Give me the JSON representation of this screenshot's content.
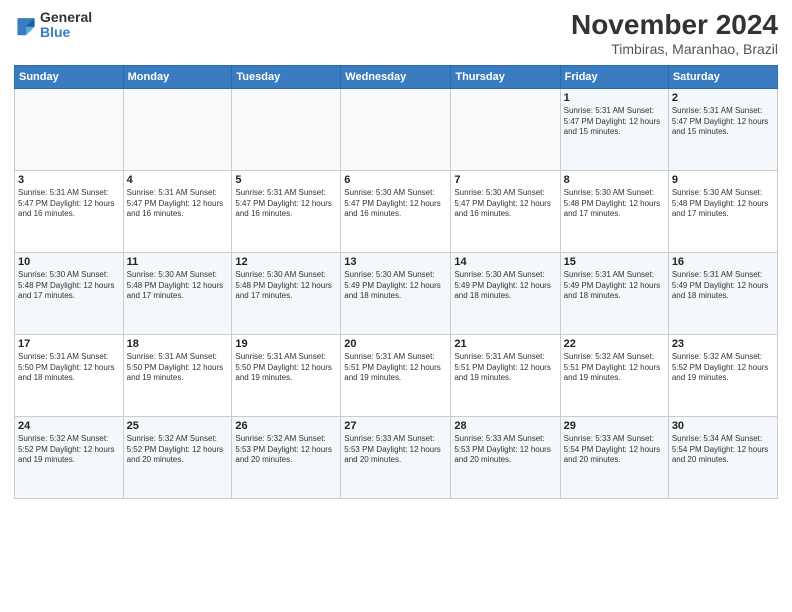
{
  "header": {
    "logo": {
      "general": "General",
      "blue": "Blue"
    },
    "title": "November 2024",
    "subtitle": "Timbiras, Maranhao, Brazil"
  },
  "weekdays": [
    "Sunday",
    "Monday",
    "Tuesday",
    "Wednesday",
    "Thursday",
    "Friday",
    "Saturday"
  ],
  "weeks": [
    [
      {
        "day": "",
        "info": ""
      },
      {
        "day": "",
        "info": ""
      },
      {
        "day": "",
        "info": ""
      },
      {
        "day": "",
        "info": ""
      },
      {
        "day": "",
        "info": ""
      },
      {
        "day": "1",
        "info": "Sunrise: 5:31 AM\nSunset: 5:47 PM\nDaylight: 12 hours\nand 15 minutes."
      },
      {
        "day": "2",
        "info": "Sunrise: 5:31 AM\nSunset: 5:47 PM\nDaylight: 12 hours\nand 15 minutes."
      }
    ],
    [
      {
        "day": "3",
        "info": "Sunrise: 5:31 AM\nSunset: 5:47 PM\nDaylight: 12 hours\nand 16 minutes."
      },
      {
        "day": "4",
        "info": "Sunrise: 5:31 AM\nSunset: 5:47 PM\nDaylight: 12 hours\nand 16 minutes."
      },
      {
        "day": "5",
        "info": "Sunrise: 5:31 AM\nSunset: 5:47 PM\nDaylight: 12 hours\nand 16 minutes."
      },
      {
        "day": "6",
        "info": "Sunrise: 5:30 AM\nSunset: 5:47 PM\nDaylight: 12 hours\nand 16 minutes."
      },
      {
        "day": "7",
        "info": "Sunrise: 5:30 AM\nSunset: 5:47 PM\nDaylight: 12 hours\nand 16 minutes."
      },
      {
        "day": "8",
        "info": "Sunrise: 5:30 AM\nSunset: 5:48 PM\nDaylight: 12 hours\nand 17 minutes."
      },
      {
        "day": "9",
        "info": "Sunrise: 5:30 AM\nSunset: 5:48 PM\nDaylight: 12 hours\nand 17 minutes."
      }
    ],
    [
      {
        "day": "10",
        "info": "Sunrise: 5:30 AM\nSunset: 5:48 PM\nDaylight: 12 hours\nand 17 minutes."
      },
      {
        "day": "11",
        "info": "Sunrise: 5:30 AM\nSunset: 5:48 PM\nDaylight: 12 hours\nand 17 minutes."
      },
      {
        "day": "12",
        "info": "Sunrise: 5:30 AM\nSunset: 5:48 PM\nDaylight: 12 hours\nand 17 minutes."
      },
      {
        "day": "13",
        "info": "Sunrise: 5:30 AM\nSunset: 5:49 PM\nDaylight: 12 hours\nand 18 minutes."
      },
      {
        "day": "14",
        "info": "Sunrise: 5:30 AM\nSunset: 5:49 PM\nDaylight: 12 hours\nand 18 minutes."
      },
      {
        "day": "15",
        "info": "Sunrise: 5:31 AM\nSunset: 5:49 PM\nDaylight: 12 hours\nand 18 minutes."
      },
      {
        "day": "16",
        "info": "Sunrise: 5:31 AM\nSunset: 5:49 PM\nDaylight: 12 hours\nand 18 minutes."
      }
    ],
    [
      {
        "day": "17",
        "info": "Sunrise: 5:31 AM\nSunset: 5:50 PM\nDaylight: 12 hours\nand 18 minutes."
      },
      {
        "day": "18",
        "info": "Sunrise: 5:31 AM\nSunset: 5:50 PM\nDaylight: 12 hours\nand 19 minutes."
      },
      {
        "day": "19",
        "info": "Sunrise: 5:31 AM\nSunset: 5:50 PM\nDaylight: 12 hours\nand 19 minutes."
      },
      {
        "day": "20",
        "info": "Sunrise: 5:31 AM\nSunset: 5:51 PM\nDaylight: 12 hours\nand 19 minutes."
      },
      {
        "day": "21",
        "info": "Sunrise: 5:31 AM\nSunset: 5:51 PM\nDaylight: 12 hours\nand 19 minutes."
      },
      {
        "day": "22",
        "info": "Sunrise: 5:32 AM\nSunset: 5:51 PM\nDaylight: 12 hours\nand 19 minutes."
      },
      {
        "day": "23",
        "info": "Sunrise: 5:32 AM\nSunset: 5:52 PM\nDaylight: 12 hours\nand 19 minutes."
      }
    ],
    [
      {
        "day": "24",
        "info": "Sunrise: 5:32 AM\nSunset: 5:52 PM\nDaylight: 12 hours\nand 19 minutes."
      },
      {
        "day": "25",
        "info": "Sunrise: 5:32 AM\nSunset: 5:52 PM\nDaylight: 12 hours\nand 20 minutes."
      },
      {
        "day": "26",
        "info": "Sunrise: 5:32 AM\nSunset: 5:53 PM\nDaylight: 12 hours\nand 20 minutes."
      },
      {
        "day": "27",
        "info": "Sunrise: 5:33 AM\nSunset: 5:53 PM\nDaylight: 12 hours\nand 20 minutes."
      },
      {
        "day": "28",
        "info": "Sunrise: 5:33 AM\nSunset: 5:53 PM\nDaylight: 12 hours\nand 20 minutes."
      },
      {
        "day": "29",
        "info": "Sunrise: 5:33 AM\nSunset: 5:54 PM\nDaylight: 12 hours\nand 20 minutes."
      },
      {
        "day": "30",
        "info": "Sunrise: 5:34 AM\nSunset: 5:54 PM\nDaylight: 12 hours\nand 20 minutes."
      }
    ]
  ]
}
